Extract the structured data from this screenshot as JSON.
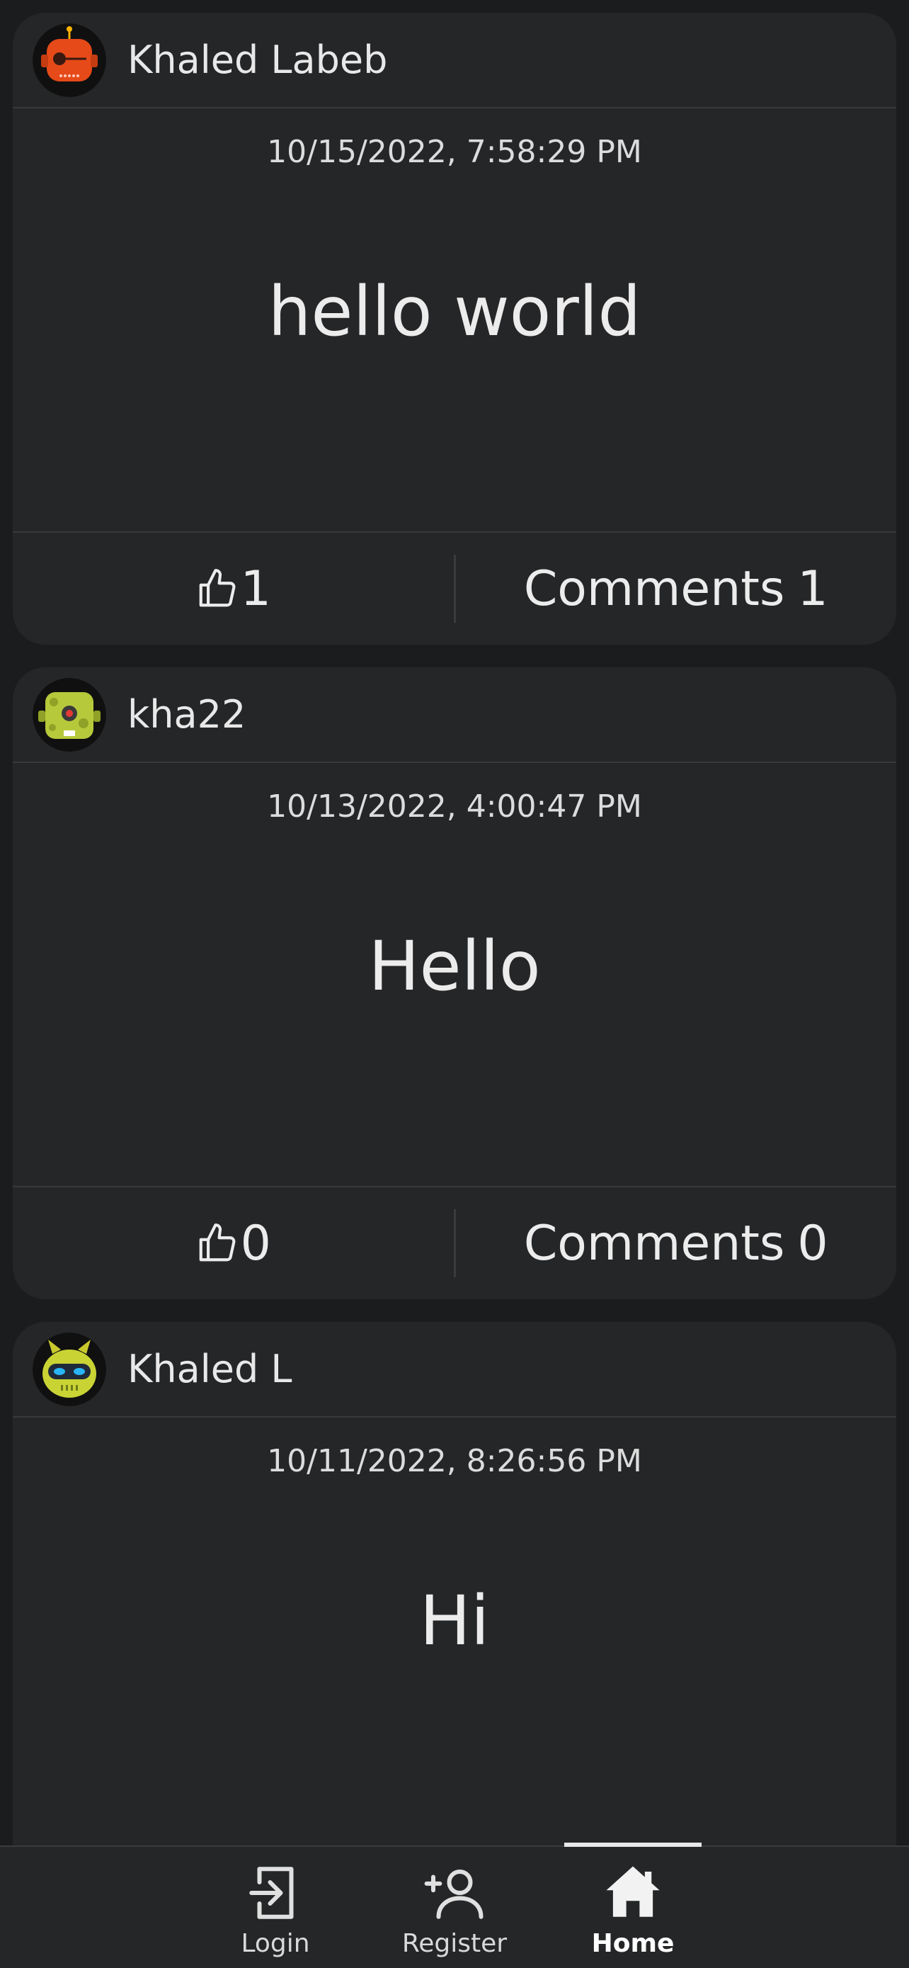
{
  "posts": [
    {
      "author": "Khaled Labeb",
      "avatar_icon": "red-robot-avatar",
      "timestamp": "10/15/2022, 7:58:29 PM",
      "body": "hello world",
      "likes": "1",
      "comments_label": "Comments",
      "comments_count": "1"
    },
    {
      "author": "kha22",
      "avatar_icon": "green-cyclops-robot-avatar",
      "timestamp": "10/13/2022, 4:00:47 PM",
      "body": "Hello",
      "likes": "0",
      "comments_label": "Comments",
      "comments_count": "0"
    },
    {
      "author": "Khaled L",
      "avatar_icon": "yellow-horned-robot-avatar",
      "timestamp": "10/11/2022, 8:26:56 PM",
      "body": "Hi"
    }
  ],
  "nav": {
    "login": "Login",
    "register": "Register",
    "home": "Home",
    "active": "home"
  },
  "colors": {
    "background": "#1b1c1e",
    "card": "#252628",
    "text": "#e6e6e6"
  }
}
